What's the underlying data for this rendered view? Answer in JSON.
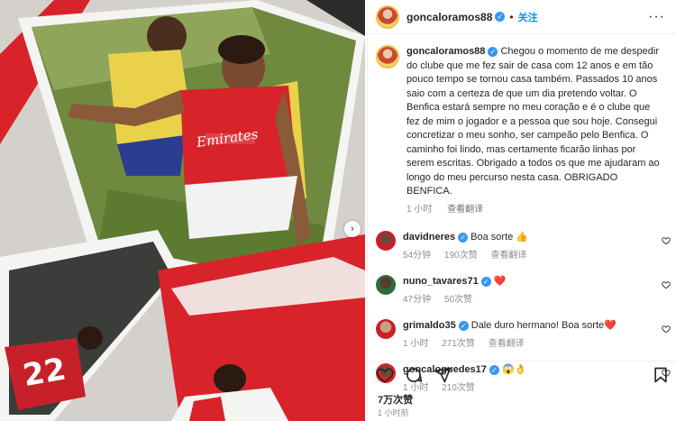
{
  "post": {
    "username": "goncaloramos88",
    "follow_label": "关注",
    "more_label": "···"
  },
  "caption": {
    "username": "goncaloramos88",
    "text": "Chegou o momento de me despedir do clube que me fez sair de casa com 12 anos e em tão pouco tempo se tornou casa também. Passados 10 anos saio com a certeza de que um dia pretendo voltar. O Benfica estará sempre no meu coração e é o clube que fez de mim o jogador e a pessoa que sou hoje. Consegui concretizar o meu sonho, ser campeão pelo Benfica. O caminho foi lindo, mas certamente ficarão linhas por serem escritas. Obrigado a todos os que me ajudaram ao longo do meu percurso nesta casa. OBRIGADO BENFICA.",
    "time": "1 小时",
    "translate": "查看翻译"
  },
  "comments": [
    {
      "username": "davidneres",
      "text": "Boa sorte 👍",
      "time": "54分钟",
      "likes": "190次赞",
      "reply": "查看翻译",
      "verified": true
    },
    {
      "username": "nuno_tavares71",
      "text": "❤️",
      "time": "47分钟",
      "likes": "50次赞",
      "reply": "",
      "verified": true
    },
    {
      "username": "grimaldo35",
      "text": "Dale duro hermano! Boa sorte❤️",
      "time": "1 小时",
      "likes": "271次赞",
      "reply": "查看翻译",
      "verified": true
    },
    {
      "username": "goncaloguedes17",
      "text": "😱👌",
      "time": "1 小时",
      "likes": "210次赞",
      "reply": "",
      "verified": true
    }
  ],
  "stats": {
    "likes": "7万次赞",
    "time": "1 小时前"
  },
  "photo": {
    "jersey_text": "Emirates",
    "back_number": "22"
  },
  "colors": {
    "accent": "#0095f6",
    "benfica_red": "#e0202a",
    "verified": "#3897f0"
  },
  "icons": [
    "heart-icon",
    "comment-icon",
    "share-icon",
    "bookmark-icon",
    "verified-icon",
    "chevron-right-icon"
  ]
}
